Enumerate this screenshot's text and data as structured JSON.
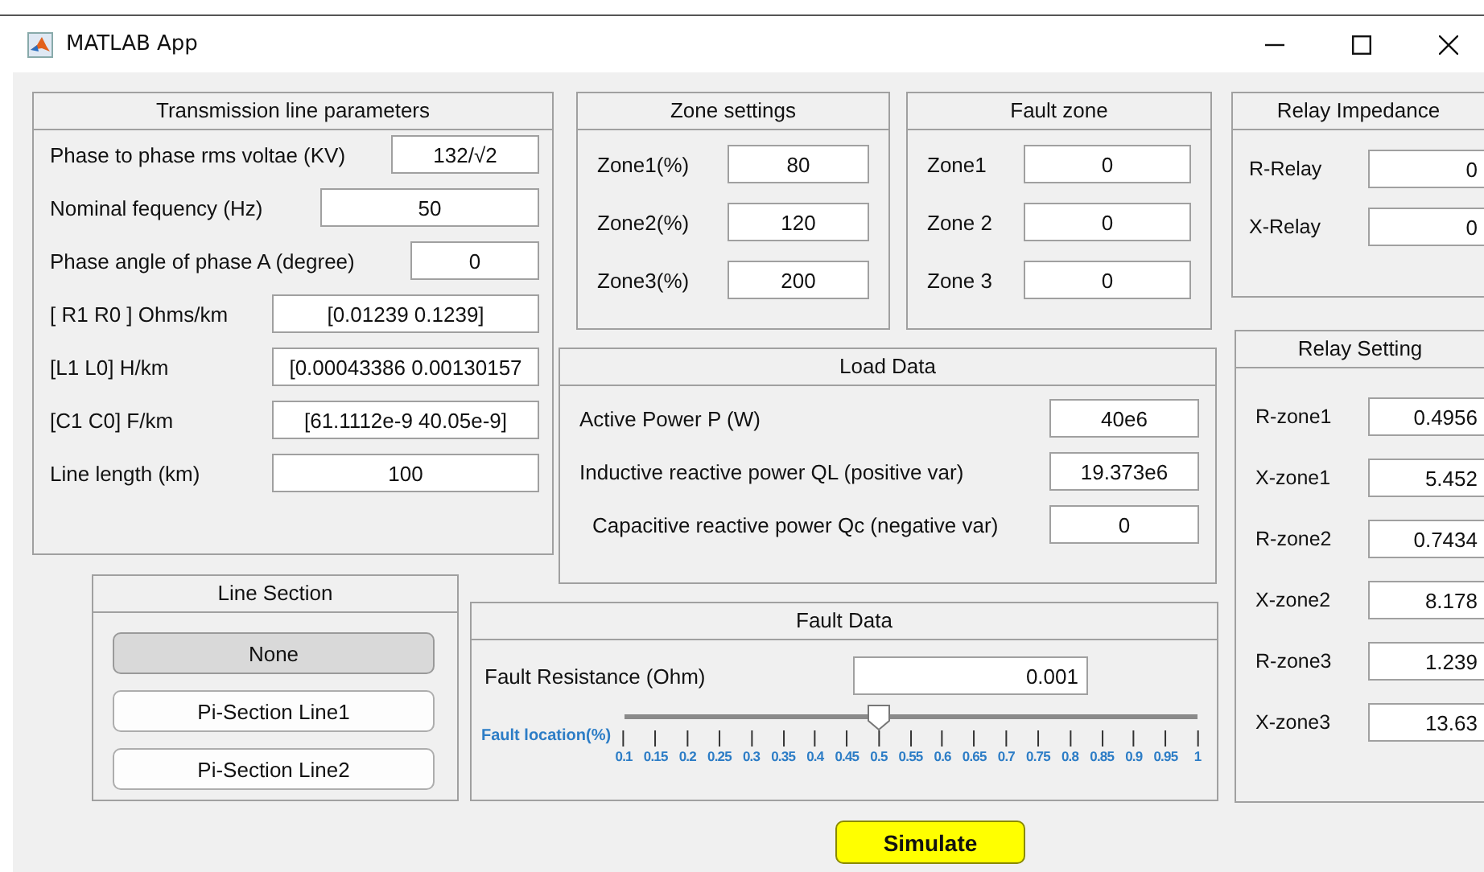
{
  "window": {
    "title": "MATLAB App"
  },
  "transmission_line": {
    "title": "Transmission line parameters",
    "fields": [
      {
        "label": "Phase to phase rms voltae (KV)",
        "value": "132/√2"
      },
      {
        "label": "Nominal fequency (Hz)",
        "value": "50"
      },
      {
        "label": "Phase angle of phase A (degree)",
        "value": "0"
      },
      {
        "label": "[ R1  R0 ] Ohms/km",
        "value": "[0.01239 0.1239]"
      },
      {
        "label": "[L1 L0] H/km",
        "value": "[0.00043386 0.00130157"
      },
      {
        "label": "[C1 C0] F/km",
        "value": "[61.1112e-9 40.05e-9]"
      },
      {
        "label": "Line length (km)",
        "value": "100"
      }
    ]
  },
  "zone_settings": {
    "title": "Zone settings",
    "fields": [
      {
        "label": "Zone1(%)",
        "value": "80"
      },
      {
        "label": "Zone2(%)",
        "value": "120"
      },
      {
        "label": "Zone3(%)",
        "value": "200"
      }
    ]
  },
  "fault_zone": {
    "title": "Fault zone",
    "fields": [
      {
        "label": "Zone1",
        "value": "0"
      },
      {
        "label": "Zone 2",
        "value": "0"
      },
      {
        "label": "Zone 3",
        "value": "0"
      }
    ]
  },
  "relay_impedance": {
    "title": "Relay Impedance",
    "fields": [
      {
        "label": "R-Relay",
        "value": "0"
      },
      {
        "label": "X-Relay",
        "value": "0"
      }
    ]
  },
  "load_data": {
    "title": "Load Data",
    "fields": [
      {
        "label": "Active Power P (W)",
        "value": "40e6"
      },
      {
        "label": "Inductive reactive power QL (positive var)",
        "value": "19.373e6"
      },
      {
        "label": "Capacitive reactive power Qc (negative var)",
        "value": "0"
      }
    ]
  },
  "relay_setting": {
    "title": "Relay Setting",
    "fields": [
      {
        "label": "R-zone1",
        "value": "0.4956"
      },
      {
        "label": "X-zone1",
        "value": "5.452"
      },
      {
        "label": "R-zone2",
        "value": "0.7434"
      },
      {
        "label": "X-zone2",
        "value": "8.178"
      },
      {
        "label": "R-zone3",
        "value": "1.239"
      },
      {
        "label": "X-zone3",
        "value": "13.63"
      }
    ]
  },
  "line_section": {
    "title": "Line Section",
    "buttons": [
      {
        "label": "None",
        "selected": true
      },
      {
        "label": "Pi-Section Line1",
        "selected": false
      },
      {
        "label": "Pi-Section Line2",
        "selected": false
      }
    ]
  },
  "fault_data": {
    "title": "Fault Data",
    "resistance": {
      "label": "Fault Resistance (Ohm)",
      "value": "0.001"
    },
    "location": {
      "label": "Fault location(%)",
      "level": 0.444,
      "ticks": [
        "0.1",
        "0.15",
        "0.2",
        "0.25",
        "0.3",
        "0.35",
        "0.4",
        "0.45",
        "0.5",
        "0.55",
        "0.6",
        "0.65",
        "0.7",
        "0.75",
        "0.8",
        "0.85",
        "0.9",
        "0.95",
        "1"
      ]
    }
  },
  "simulate_button": {
    "label": "Simulate"
  }
}
